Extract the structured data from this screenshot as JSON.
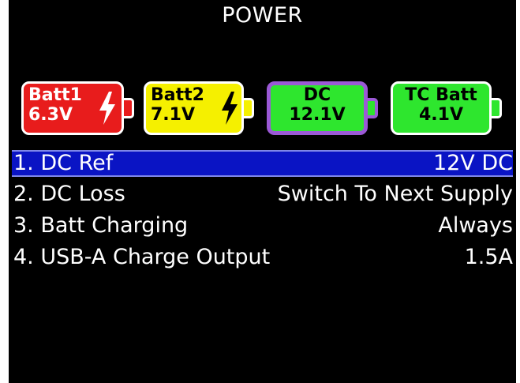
{
  "header": {
    "title": "POWER"
  },
  "supplies": [
    {
      "name": "Batt1",
      "voltage": "6.3V",
      "color": "#e81c1c",
      "text_color": "#ffffff",
      "icon": "bolt-icon",
      "selected": false
    },
    {
      "name": "Batt2",
      "voltage": "7.1V",
      "color": "#f5f000",
      "text_color": "#000000",
      "icon": "bolt-icon",
      "selected": false
    },
    {
      "name": "DC",
      "voltage": "12.1V",
      "color": "#2ee62e",
      "text_color": "#000000",
      "selected": true
    },
    {
      "name": "TC Batt",
      "voltage": "4.1V",
      "color": "#2ee62e",
      "text_color": "#000000",
      "selected": false
    }
  ],
  "menu": {
    "items": [
      {
        "label": "1. DC Ref",
        "value": "12V DC",
        "selected": true
      },
      {
        "label": "2. DC Loss",
        "value": "Switch To Next Supply",
        "selected": false
      },
      {
        "label": "3. Batt Charging",
        "value": "Always",
        "selected": false
      },
      {
        "label": "4. USB-A Charge Output",
        "value": "1.5A",
        "selected": false
      }
    ]
  },
  "colors": {
    "background": "#000000",
    "selection": "#0a14c4",
    "selected_supply_border": "#9b59d6"
  }
}
